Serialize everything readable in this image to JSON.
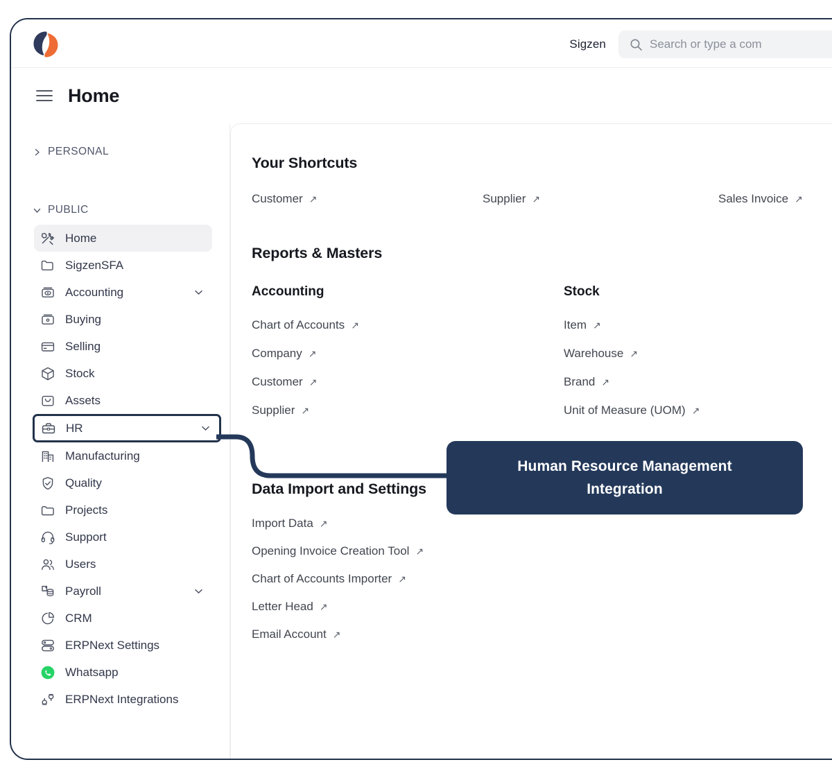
{
  "topbar": {
    "logo_icon": "sigzen-logo-icon",
    "org_name": "Sigzen",
    "search_icon": "search-icon",
    "search_placeholder": "Search or type a com",
    "search_value": ""
  },
  "page": {
    "menu_icon": "hamburger-menu-icon",
    "title": "Home"
  },
  "sidebar": {
    "groups": [
      {
        "label": "PERSONAL",
        "chevron": "chevron-right-icon",
        "expanded": false
      },
      {
        "label": "PUBLIC",
        "chevron": "chevron-down-icon",
        "expanded": true
      }
    ],
    "items": [
      {
        "label": "Home",
        "icon": "tools-icon",
        "state": "active",
        "chevron": ""
      },
      {
        "label": "SigzenSFA",
        "icon": "folder-icon",
        "state": "normal",
        "chevron": ""
      },
      {
        "label": "Accounting",
        "icon": "accounting-icon",
        "state": "normal",
        "chevron": "chevron-down-icon"
      },
      {
        "label": "Buying",
        "icon": "buying-icon",
        "state": "normal",
        "chevron": ""
      },
      {
        "label": "Selling",
        "icon": "selling-card-icon",
        "state": "normal",
        "chevron": ""
      },
      {
        "label": "Stock",
        "icon": "box-3d-icon",
        "state": "normal",
        "chevron": ""
      },
      {
        "label": "Assets",
        "icon": "assets-bag-icon",
        "state": "normal",
        "chevron": ""
      },
      {
        "label": "HR",
        "icon": "briefcase-icon",
        "state": "highlighted",
        "chevron": "chevron-down-icon"
      },
      {
        "label": "Manufacturing",
        "icon": "factory-icon",
        "state": "normal",
        "chevron": ""
      },
      {
        "label": "Quality",
        "icon": "shield-check-icon",
        "state": "normal",
        "chevron": ""
      },
      {
        "label": "Projects",
        "icon": "folder-open-icon",
        "state": "normal",
        "chevron": ""
      },
      {
        "label": "Support",
        "icon": "headset-icon",
        "state": "normal",
        "chevron": ""
      },
      {
        "label": "Users",
        "icon": "users-icon",
        "state": "normal",
        "chevron": ""
      },
      {
        "label": "Payroll",
        "icon": "payroll-icon",
        "state": "normal",
        "chevron": "chevron-down-icon"
      },
      {
        "label": "CRM",
        "icon": "pie-chart-icon",
        "state": "normal",
        "chevron": ""
      },
      {
        "label": "ERPNext Settings",
        "icon": "server-icon",
        "state": "normal",
        "chevron": ""
      },
      {
        "label": "Whatsapp",
        "icon": "whatsapp-icon",
        "state": "normal",
        "chevron": ""
      },
      {
        "label": "ERPNext Integrations",
        "icon": "plug-connect-icon",
        "state": "normal",
        "chevron": ""
      }
    ]
  },
  "main": {
    "shortcuts": {
      "title": "Your Shortcuts",
      "items": [
        {
          "label": "Customer",
          "icon": "external-link-arrow-icon"
        },
        {
          "label": "Supplier",
          "icon": "external-link-arrow-icon"
        },
        {
          "label": "Sales Invoice",
          "icon": "external-link-arrow-icon"
        }
      ]
    },
    "reports_masters": {
      "title": "Reports & Masters",
      "columns": [
        {
          "title": "Accounting",
          "items": [
            {
              "label": "Chart of Accounts",
              "icon": "external-link-arrow-icon"
            },
            {
              "label": "Company",
              "icon": "external-link-arrow-icon"
            },
            {
              "label": "Customer",
              "icon": "external-link-arrow-icon"
            },
            {
              "label": "Supplier",
              "icon": "external-link-arrow-icon"
            }
          ]
        },
        {
          "title": "Stock",
          "items": [
            {
              "label": "Item",
              "icon": "external-link-arrow-icon"
            },
            {
              "label": "Warehouse",
              "icon": "external-link-arrow-icon"
            },
            {
              "label": "Brand",
              "icon": "external-link-arrow-icon"
            },
            {
              "label": "Unit of Measure (UOM)",
              "icon": "external-link-arrow-icon"
            }
          ]
        }
      ]
    },
    "data_import": {
      "title": "Data Import and Settings",
      "items": [
        {
          "label": "Import Data",
          "icon": "external-link-arrow-icon"
        },
        {
          "label": "Opening Invoice Creation Tool",
          "icon": "external-link-arrow-icon"
        },
        {
          "label": "Chart of Accounts Importer",
          "icon": "external-link-arrow-icon"
        },
        {
          "label": "Letter Head",
          "icon": "external-link-arrow-icon"
        },
        {
          "label": "Email Account",
          "icon": "external-link-arrow-icon"
        }
      ]
    }
  },
  "callout": {
    "line1": "Human Resource Management",
    "line2": "Integration",
    "background_color": "#24395a",
    "text_color": "#ffffff",
    "connector_color": "#24395a",
    "anchor_item": "HR"
  },
  "colors": {
    "window_border": "#22324a",
    "brand_navy": "#2f3a5c",
    "brand_orange": "#ee6d36",
    "whatsapp_green": "#25d366",
    "sidebar_active_bg": "#f1f1f3",
    "text_primary": "#16181f",
    "text_secondary": "#41464f"
  },
  "arrow_glyph": "↗"
}
